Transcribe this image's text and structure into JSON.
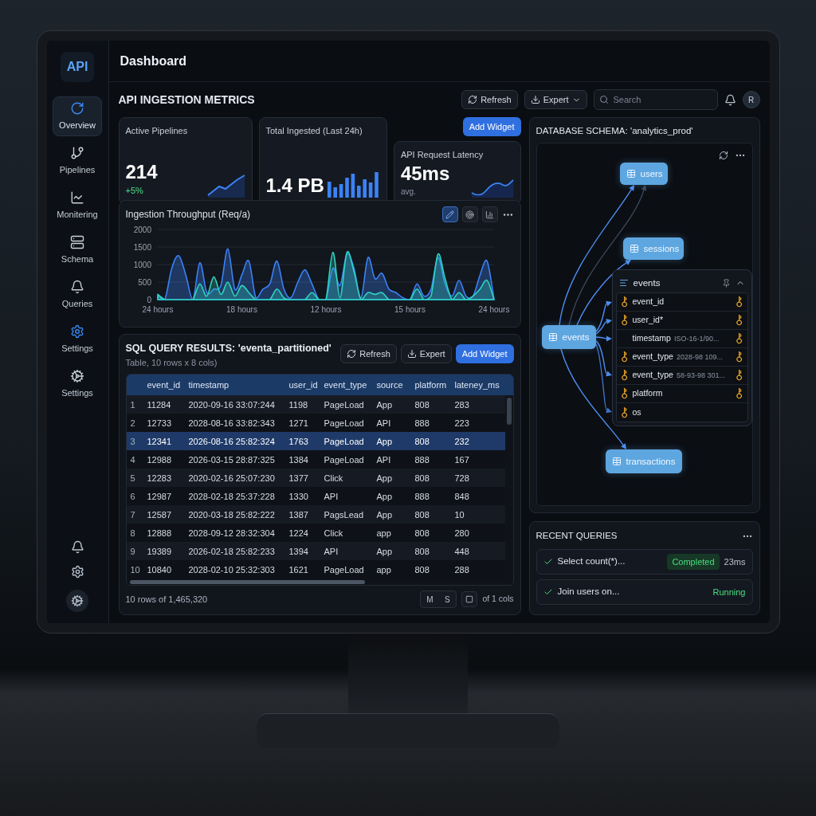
{
  "sidebar": {
    "logo": "API",
    "items": [
      {
        "label": "Overview",
        "selected": true,
        "accent": true
      },
      {
        "label": "Pipelines",
        "selected": false,
        "accent": false
      },
      {
        "label": "Monitering",
        "selected": false,
        "accent": false
      },
      {
        "label": "Schema",
        "selected": false,
        "accent": false
      },
      {
        "label": "Queries",
        "selected": false,
        "accent": false
      },
      {
        "label": "Settings",
        "selected": false,
        "accent": true
      },
      {
        "label": "Settings",
        "selected": false,
        "accent": false
      }
    ]
  },
  "header": {
    "title": "Dashboard"
  },
  "metrics": {
    "title": "API INGESTION METRICS",
    "add_widget": "Add Widget",
    "cards": [
      {
        "title": "Active Pipelines",
        "value": "214",
        "delta": "+5%",
        "kind": "trend"
      },
      {
        "title": "Total Ingested (Last 24h)",
        "value": "1.4 PB",
        "kind": "bars"
      },
      {
        "title": "API Request Latency",
        "value": "45ms",
        "note": "avg.",
        "kind": "wave"
      }
    ]
  },
  "toolbar": {
    "buttons": [
      {
        "label": "Refresh",
        "kind": "refresh"
      },
      {
        "label": "Expert",
        "kind": "dropdown"
      }
    ],
    "search": {
      "placeholder": "Search"
    },
    "avatar": "R"
  },
  "throughput": {
    "tools": [
      {
        "selected": true
      },
      {
        "selected": false
      },
      {
        "selected": false
      }
    ],
    "chart_data": {
      "type": "area",
      "title": "Ingestion Throughput (Req/a)",
      "categories": [
        "24 hours",
        null,
        null,
        null,
        null,
        null,
        null,
        null,
        null,
        null,
        null,
        null,
        "18 hours",
        null,
        null,
        null,
        null,
        null,
        null,
        null,
        null,
        null,
        null,
        null,
        "12 hours",
        null,
        null,
        null,
        null,
        null,
        null,
        null,
        null,
        null,
        null,
        null,
        "15 hours",
        null,
        null,
        null,
        null,
        null,
        null,
        null,
        null,
        null,
        null,
        null,
        "24 hours"
      ],
      "series": [
        {
          "color": "#3b82f6",
          "values": [
            100,
            0,
            900,
            1250,
            700,
            0,
            1050,
            200,
            300,
            400,
            1450,
            300,
            700,
            1100,
            50,
            300,
            450,
            1100,
            300,
            50,
            500,
            850,
            450,
            0,
            0,
            900,
            400,
            1300,
            900,
            50,
            1200,
            600,
            750,
            300,
            200,
            50,
            0,
            450,
            100,
            300,
            1200,
            450,
            100,
            550,
            100,
            100,
            700,
            1100,
            0
          ]
        },
        {
          "color": "#2dd4bf",
          "values": [
            150,
            0,
            0,
            0,
            0,
            0,
            450,
            100,
            650,
            150,
            500,
            100,
            400,
            200,
            0,
            0,
            0,
            300,
            50,
            0,
            0,
            0,
            200,
            0,
            0,
            1350,
            50,
            1350,
            800,
            0,
            200,
            150,
            200,
            0,
            0,
            0,
            0,
            300,
            0,
            100,
            1300,
            600,
            0,
            200,
            0,
            100,
            300,
            550,
            0
          ]
        }
      ],
      "ylim": [
        0,
        2000
      ],
      "yticks": [
        0,
        500,
        1000,
        1500,
        2000
      ],
      "grid": true
    }
  },
  "results": {
    "title": "SQL QUERY RESULTS: 'eventa_partitioned'",
    "subtitle": "Table, 10 rows x 8 cols)",
    "buttons": [
      {
        "label": "Refresh",
        "kind": "refresh"
      },
      {
        "label": "Expert",
        "kind": "export"
      },
      {
        "label": "Add Widget",
        "kind": "primary"
      }
    ],
    "columns": [
      "event_id",
      "timestamp",
      "user_id",
      "event_type",
      "source",
      "platform",
      "lateney_ms"
    ],
    "rows": [
      {
        "row_number": "1",
        "selected": false,
        "cells": [
          "11284",
          "2020-09-16 33:07:244",
          "1198",
          "PageLoad",
          "App",
          "808",
          "283"
        ]
      },
      {
        "row_number": "2",
        "selected": false,
        "cells": [
          "12733",
          "2028-08-16 33:82:343",
          "1271",
          "PageLoad",
          "API",
          "888",
          "223"
        ]
      },
      {
        "row_number": "3",
        "selected": true,
        "cells": [
          "12341",
          "2026-08-16 25:82:324",
          "1763",
          "PageLoad",
          "App",
          "808",
          "232"
        ]
      },
      {
        "row_number": "4",
        "selected": false,
        "cells": [
          "12988",
          "2026-03-15 28:87:325",
          "1384",
          "PageLoad",
          "API",
          "888",
          "167"
        ]
      },
      {
        "row_number": "5",
        "selected": false,
        "cells": [
          "12283",
          "2020-02-16 25:07:230",
          "1377",
          "Click",
          "App",
          "808",
          "728"
        ]
      },
      {
        "row_number": "6",
        "selected": false,
        "cells": [
          "12987",
          "2028-02-18 25:37:228",
          "1330",
          "API",
          "App",
          "888",
          "848"
        ]
      },
      {
        "row_number": "7",
        "selected": false,
        "cells": [
          "12587",
          "2020-03-18 25:82:222",
          "1387",
          "PagsLead",
          "App",
          "808",
          "10"
        ]
      },
      {
        "row_number": "8",
        "selected": false,
        "cells": [
          "12888",
          "2028-09-12 28:32:304",
          "1224",
          "Click",
          "app",
          "808",
          "280"
        ]
      },
      {
        "row_number": "9",
        "selected": false,
        "cells": [
          "19389",
          "2026-02-18 25:82:233",
          "1394",
          "API",
          "App",
          "808",
          "448"
        ]
      },
      {
        "row_number": "10",
        "selected": false,
        "cells": [
          "10840",
          "2028-02-10 25:32:303",
          "1621",
          "PageLoad",
          "app",
          "808",
          "288"
        ]
      }
    ],
    "footer": "10 rows of 1,465,320",
    "pager": {
      "pages": [
        "M",
        "S"
      ],
      "label": "of 1 cols"
    }
  },
  "schema": {
    "title": "DATABASE SCHEMA: 'analytics_prod'",
    "nodes": [
      {
        "label": "users",
        "kind": "table"
      },
      {
        "label": "sessions",
        "kind": "table"
      },
      {
        "label": "events",
        "kind": "table"
      },
      {
        "label": "events",
        "kind": "detail",
        "expanded": true,
        "fields": [
          {
            "name": "event_id",
            "leading_key": true,
            "trailing_key": true
          },
          {
            "name": "user_id*",
            "leading_key": true,
            "trailing_key": true
          },
          {
            "name": "timestamp",
            "value": "ISO-16-1/90...",
            "leading_key": false,
            "trailing_key": true
          },
          {
            "name": "event_type",
            "value": "2028-98 109...",
            "leading_key": true,
            "trailing_key": true
          },
          {
            "name": "event_type",
            "value": "58-93-98 301...",
            "leading_key": true,
            "trailing_key": true
          },
          {
            "name": "platform",
            "leading_key": true,
            "trailing_key": true
          },
          {
            "name": "os",
            "leading_key": true,
            "trailing_key": false
          }
        ]
      },
      {
        "label": "transactions",
        "kind": "table"
      }
    ]
  },
  "recent_queries": {
    "title": "RECENT QUERIES",
    "items": [
      {
        "query": "Select count(*)...",
        "status": "Completed",
        "kind": "completed",
        "duration": "23ms"
      },
      {
        "query": "Join users on...",
        "status": "Running",
        "kind": "running"
      }
    ]
  }
}
